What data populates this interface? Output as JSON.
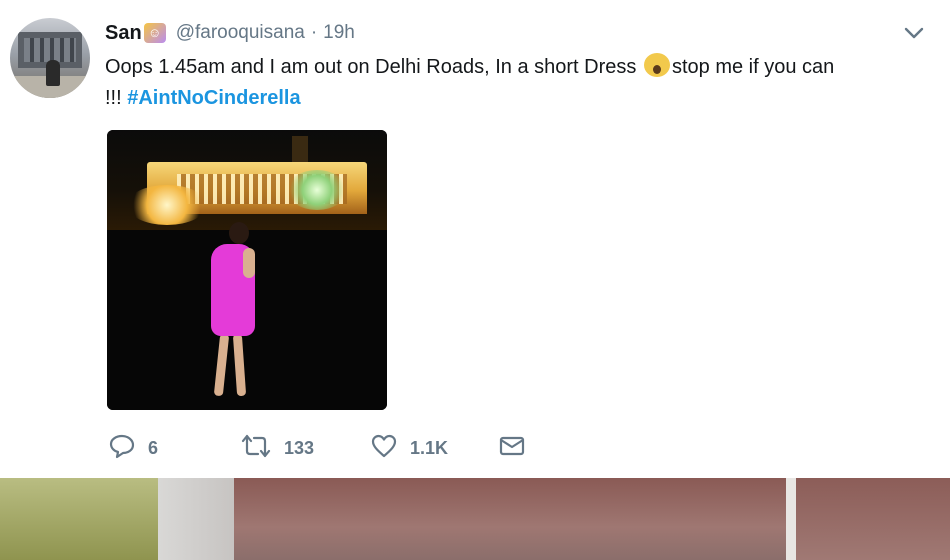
{
  "tweet": {
    "author_name": "San",
    "author_name_emoji": "name-emoji",
    "handle": "@farooquisana",
    "separator": "·",
    "time": "19h",
    "text_part1": "Oops 1.45am and I am out on Delhi Roads, In a short Dress ",
    "text_emoji": "face-screaming-in-fear",
    "text_part2": "stop me if you can",
    "text_line2_prefix": "!!! ",
    "hashtag": "#AintNoCinderella",
    "media_icon": "night-photo-woman-pink-dress"
  },
  "actions": {
    "reply_count": "6",
    "retweet_count": "133",
    "like_count": "1.1K"
  },
  "colors": {
    "link": "#1b95e0",
    "muted": "#657786",
    "text": "#14171a"
  }
}
